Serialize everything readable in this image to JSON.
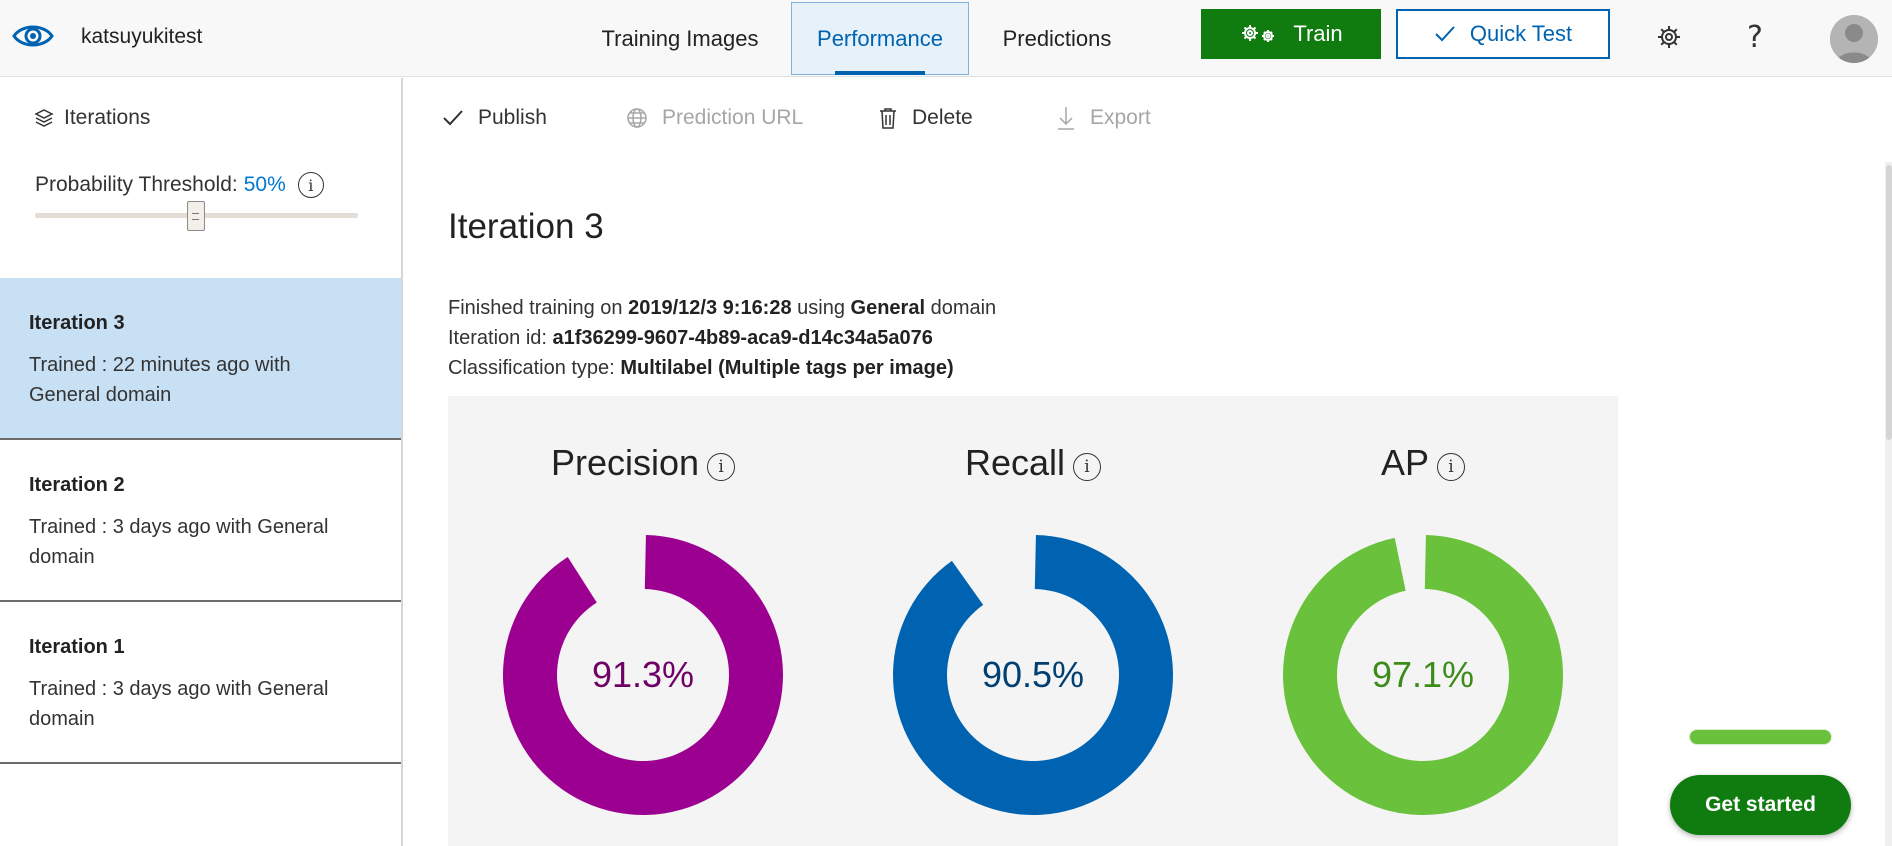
{
  "app": {
    "project_name": "katsuyukitest",
    "logo_icon": "eye-icon"
  },
  "nav": {
    "tabs": [
      {
        "label": "Training Images",
        "active": false
      },
      {
        "label": "Performance",
        "active": true
      },
      {
        "label": "Predictions",
        "active": false
      }
    ],
    "train_label": "Train",
    "quick_test_label": "Quick Test",
    "help_glyph": "?"
  },
  "sidebar": {
    "header": "Iterations",
    "threshold_label": "Probability Threshold:",
    "threshold_value": "50%",
    "threshold_fraction": 0.5,
    "iterations": [
      {
        "name": "Iteration 3",
        "desc": "Trained : 22 minutes ago with General domain",
        "active": true
      },
      {
        "name": "Iteration 2",
        "desc": "Trained : 3 days ago with General domain",
        "active": false
      },
      {
        "name": "Iteration 1",
        "desc": "Trained : 3 days ago with General domain",
        "active": false
      }
    ]
  },
  "toolbar": {
    "publish": "Publish",
    "prediction_url": "Prediction URL",
    "delete": "Delete",
    "export": "Export"
  },
  "main": {
    "title": "Iteration 3",
    "finished_prefix": "Finished training on",
    "finished_date": "2019/12/3 9:16:28",
    "using": "using",
    "domain": "General",
    "domain_suffix": "domain",
    "iteration_id_label": "Iteration id:",
    "iteration_id": "a1f36299-9607-4b89-aca9-d14c34a5a076",
    "classification_label": "Classification type:",
    "classification_value": "Multilabel (Multiple tags per image)"
  },
  "metrics": [
    {
      "label": "Precision",
      "value": "91.3%",
      "fraction": 0.913,
      "color": "#9b0091",
      "text_color": "#6e0066"
    },
    {
      "label": "Recall",
      "value": "90.5%",
      "fraction": 0.905,
      "color": "#0063b1",
      "text_color": "#003f72"
    },
    {
      "label": "AP",
      "value": "97.1%",
      "fraction": 0.971,
      "color": "#6ac13b",
      "text_color": "#3c8c1a"
    }
  ],
  "get_started": {
    "label": "Get started",
    "accent": "#107c10"
  },
  "colors": {
    "brand_blue": "#0063b1",
    "brand_green": "#107c10",
    "selection": "#c7e0f4"
  }
}
